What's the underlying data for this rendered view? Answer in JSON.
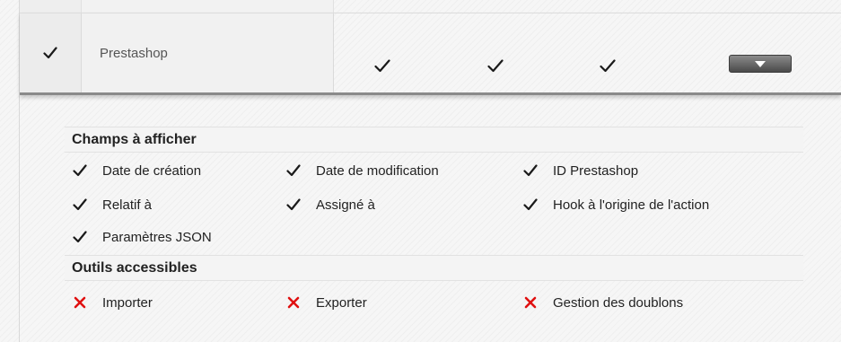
{
  "row": {
    "name": "Prestashop",
    "selected_icon": "check-icon",
    "flag_icons": [
      "check-icon",
      "check-icon",
      "check-icon"
    ],
    "menu_icon": "caret-down-icon"
  },
  "fields_section": {
    "title": "Champs à afficher",
    "items": [
      {
        "label": "Date de création",
        "icon": "check-icon"
      },
      {
        "label": "Date de modification",
        "icon": "check-icon"
      },
      {
        "label": "ID Prestashop",
        "icon": "check-icon"
      },
      {
        "label": "Relatif à",
        "icon": "check-icon"
      },
      {
        "label": "Assigné à",
        "icon": "check-icon"
      },
      {
        "label": "Hook à l'origine de l'action",
        "icon": "check-icon"
      },
      {
        "label": "Paramètres JSON",
        "icon": "check-icon"
      }
    ]
  },
  "tools_section": {
    "title": "Outils accessibles",
    "items": [
      {
        "label": "Importer",
        "icon": "cross-icon"
      },
      {
        "label": "Exporter",
        "icon": "cross-icon"
      },
      {
        "label": "Gestion des doublons",
        "icon": "cross-icon"
      }
    ]
  },
  "colors": {
    "check": "#1a1a1a",
    "cross": "#e01010"
  }
}
